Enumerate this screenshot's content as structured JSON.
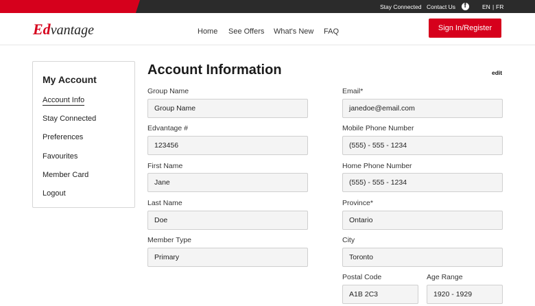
{
  "topbar": {
    "stay_connected": "Stay Connected",
    "contact_us": "Contact Us",
    "lang_en": "EN",
    "lang_sep": "|",
    "lang_fr": "FR"
  },
  "header": {
    "logo_ed": "Ed",
    "logo_rest": "vantage",
    "nav": [
      "Home",
      "See Offers",
      "What's New",
      "FAQ"
    ],
    "signin": "Sign In/Register"
  },
  "sidebar": {
    "title": "My Account",
    "items": [
      "Account Info",
      "Stay Connected",
      "Preferences",
      "Favourites",
      "Member Card",
      "Logout"
    ]
  },
  "main": {
    "title": "Account Information",
    "edit": "edit",
    "left_fields": [
      {
        "label": "Group Name",
        "value": "Group Name"
      },
      {
        "label": "Edvantage #",
        "value": "123456"
      },
      {
        "label": "First Name",
        "value": "Jane"
      },
      {
        "label": "Last Name",
        "value": "Doe"
      },
      {
        "label": "Member Type",
        "value": "Primary"
      }
    ],
    "right_fields": [
      {
        "label": "Email*",
        "value": "janedoe@email.com"
      },
      {
        "label": "Mobile Phone Number",
        "value": "(555) - 555 - 1234"
      },
      {
        "label": "Home Phone Number",
        "value": "(555) - 555 - 1234"
      },
      {
        "label": "Province*",
        "value": "Ontario"
      },
      {
        "label": "City",
        "value": "Toronto"
      }
    ],
    "postal": {
      "label": "Postal Code",
      "value": "A1B 2C3"
    },
    "age": {
      "label": "Age Range",
      "value": "1920 - 1929"
    }
  },
  "colors": {
    "brand_red": "#d6001c",
    "topbar_dark": "#2b2b2b",
    "field_bg": "#f4f4f4"
  },
  "icons": {
    "social": "facebook-icon"
  }
}
